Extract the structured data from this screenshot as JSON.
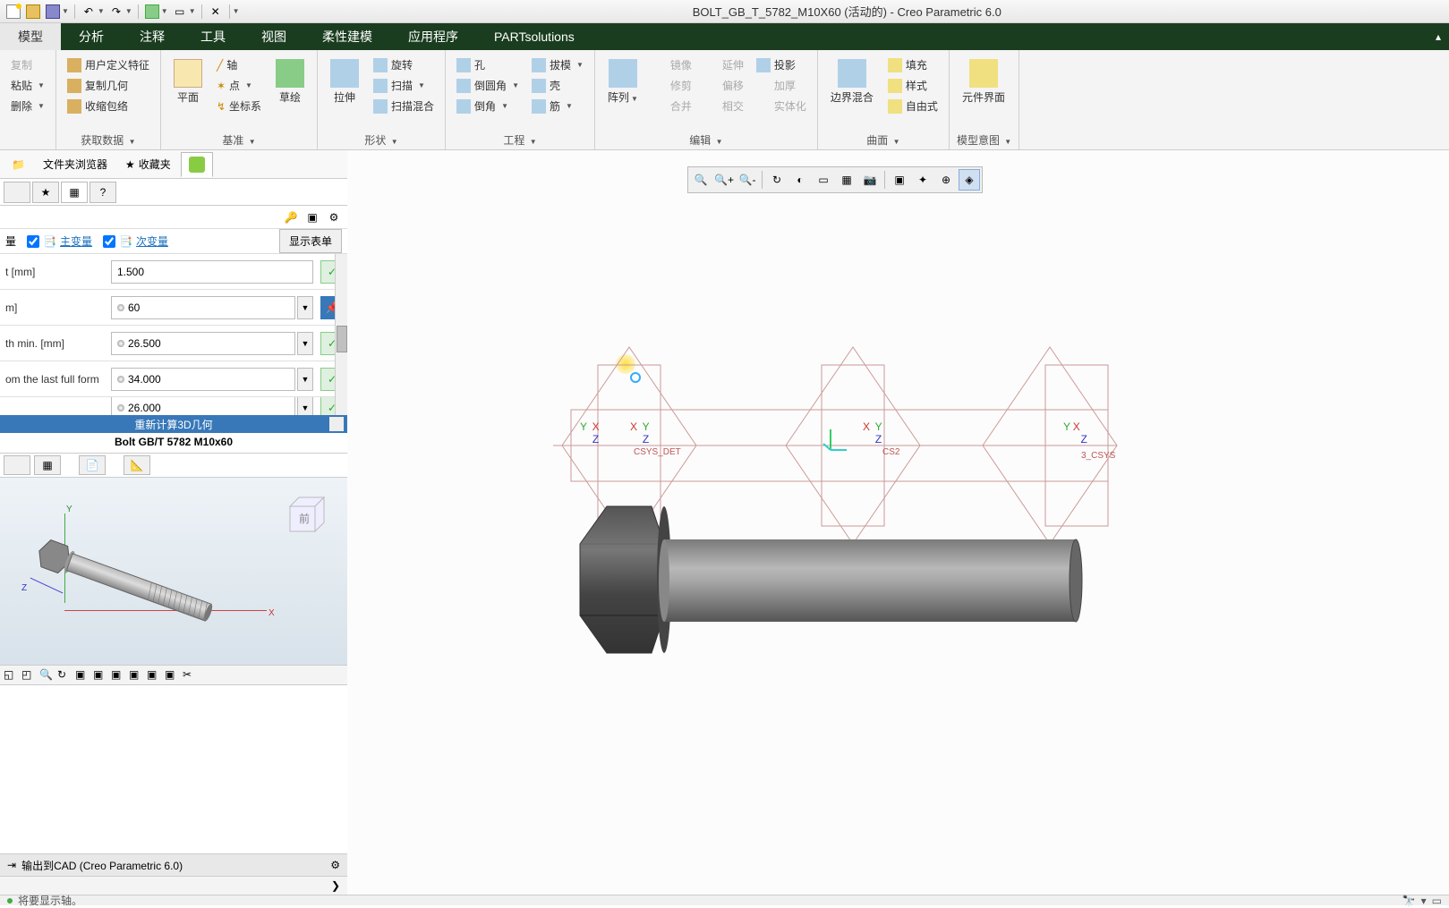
{
  "title": "BOLT_GB_T_5782_M10X60 (活动的) - Creo Parametric 6.0",
  "tabs": {
    "model": "模型",
    "analysis": "分析",
    "annotate": "注释",
    "tools": "工具",
    "view": "视图",
    "flex": "柔性建模",
    "apps": "应用程序",
    "ps": "PARTsolutions"
  },
  "ribbon": {
    "g1": {
      "copy": "复制",
      "paste": "粘贴",
      "delete": "删除"
    },
    "g2": {
      "udf": "用户定义特征",
      "copygeom": "复制几何",
      "shrink": "收缩包络",
      "label": "获取数据"
    },
    "g3": {
      "plane": "平面",
      "sketch": "草绘",
      "axis": "轴",
      "point": "点",
      "csys": "坐标系",
      "label": "基准"
    },
    "g4": {
      "extrude": "拉伸",
      "revolve": "旋转",
      "sweep": "扫描",
      "blend": "扫描混合",
      "label": "形状"
    },
    "g5": {
      "hole": "孔",
      "round": "倒圆角",
      "chamfer": "倒角",
      "draft": "拔模",
      "shell": "壳",
      "rib": "筋",
      "label": "工程"
    },
    "g6": {
      "pattern": "阵列",
      "mirror": "镜像",
      "trim": "修剪",
      "merge": "合并",
      "extend": "延伸",
      "offset": "偏移",
      "intersect": "相交",
      "project": "投影",
      "thicken": "加厚",
      "solidify": "实体化",
      "label": "编辑"
    },
    "g7": {
      "boundary": "边界混合",
      "fill": "填充",
      "style": "样式",
      "freestyle": "自由式",
      "label": "曲面"
    },
    "g8": {
      "compui": "元件界面",
      "label": "模型意图"
    }
  },
  "nav": {
    "folder": "文件夹浏览器",
    "fav": "收藏夹"
  },
  "vars": {
    "primary": "主变量",
    "secondary": "次变量",
    "showform": "显示表单"
  },
  "params": {
    "r0": {
      "label": "t [mm]",
      "value": "1.500"
    },
    "r1": {
      "label": "m]",
      "value": "60"
    },
    "r2": {
      "label": "th min. [mm]",
      "value": "26.500"
    },
    "r3": {
      "label": "om the last full form",
      "value": "34.000"
    },
    "r4": {
      "label": "",
      "value": "26.000"
    }
  },
  "recalc": "重新计算3D几何",
  "part_title": "Bolt GB/T 5782 M10x60",
  "export": "输出到CAD (Creo Parametric 6.0)",
  "status": "将要显示轴。",
  "csys": {
    "detail": "CSYS_DET",
    "cs2": "CS2",
    "cs3": "3_CSYS"
  },
  "axes": {
    "x": "X",
    "y": "Y",
    "z": "Z"
  },
  "cube": {
    "front": "前"
  }
}
